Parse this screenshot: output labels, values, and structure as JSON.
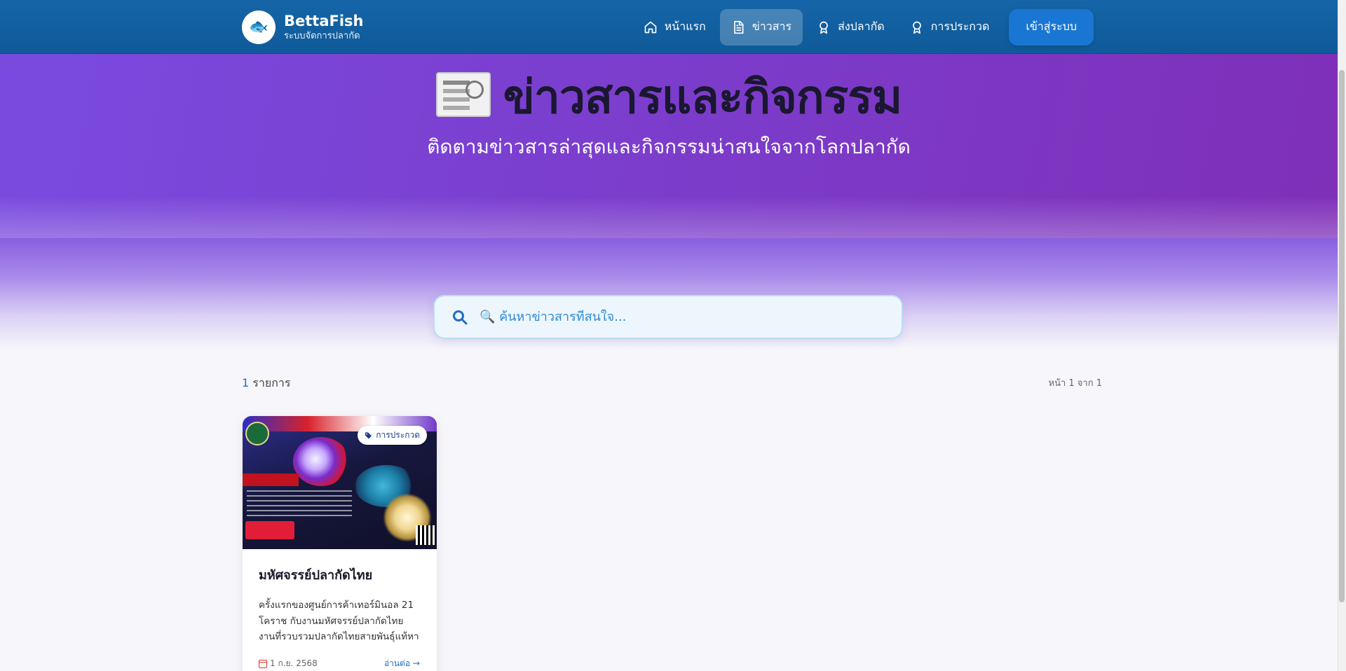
{
  "header": {
    "brand_name": "BettaFish",
    "brand_sub": "ระบบจัดการปลากัด",
    "logo": "🐟",
    "nav": [
      {
        "label": "หน้าแรก",
        "icon": "home-icon"
      },
      {
        "label": "ข่าวสาร",
        "icon": "document-icon",
        "active": true
      },
      {
        "label": "ส่งปลากัด",
        "icon": "award-icon"
      },
      {
        "label": "การประกวด",
        "icon": "award-icon"
      }
    ],
    "login_label": "เข้าสู่ระบบ"
  },
  "hero": {
    "title": "ข่าวสารและกิจกรรม",
    "subtitle": "ติดตามข่าวสารล่าสุดและกิจกรรมน่าสนใจจากโลกปลากัด"
  },
  "search": {
    "placeholder": "🔍 ค้นหาข่าวสารที่สนใจ...",
    "value": ""
  },
  "results": {
    "count": "1",
    "count_label": "รายการ",
    "page_info": "หน้า 1 จาก 1"
  },
  "cards": [
    {
      "tag": "การประกวด",
      "title": "มหัศจรรย์ปลากัดไทย",
      "description": "ครั้งแรกของศูนย์การค้าเทอร์มินอล 21 โคราช กับงานมหัศจรรย์ปลากัดไทย งานที่รวบรวมปลากัดไทยสายพันธุ์แท้หาดูยาก...",
      "date": "1 ก.ย. 2568",
      "read_more": "อ่านต่อ →"
    }
  ],
  "colors": {
    "header": "#1565a8",
    "accent": "#1976d2",
    "hero_start": "#7a4be0",
    "hero_end": "#7f2fb8"
  }
}
